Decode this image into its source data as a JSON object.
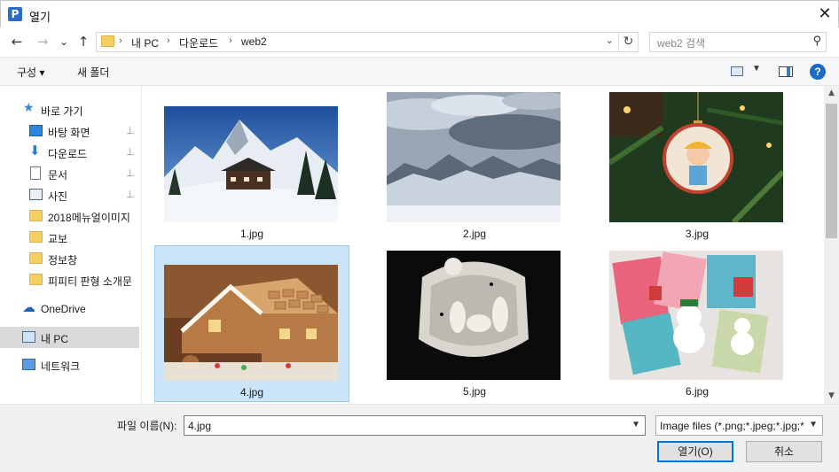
{
  "window": {
    "title": "열기",
    "app_icon_letter": "P",
    "close_glyph": "✕"
  },
  "nav": {
    "back_glyph": "←",
    "forward_glyph": "→",
    "recent_glyph": "⌄",
    "up_glyph": "↑",
    "breadcrumb": [
      "내 PC",
      "다운로드",
      "web2"
    ],
    "separator": "›",
    "refresh_glyph": "↻",
    "search_placeholder": "web2 검색",
    "search_glyph": "⚲"
  },
  "toolbar": {
    "organize_label": "구성 ▾",
    "new_folder_label": "새 폴더",
    "help_glyph": "?"
  },
  "sidebar": {
    "quick_access": "바로 가기",
    "items": [
      {
        "label": "바탕 화면",
        "pinned": true
      },
      {
        "label": "다운로드",
        "pinned": true
      },
      {
        "label": "문서",
        "pinned": true
      },
      {
        "label": "사진",
        "pinned": true
      },
      {
        "label": "2018메뉴얼이미지",
        "pinned": false
      },
      {
        "label": "교보",
        "pinned": false
      },
      {
        "label": "정보창",
        "pinned": false
      },
      {
        "label": "피피티 판형 소개문",
        "pinned": false
      }
    ],
    "onedrive": "OneDrive",
    "this_pc": "내 PC",
    "network": "네트워크",
    "pin_glyph": "📌"
  },
  "files": [
    {
      "name": "1.jpg",
      "selected": false
    },
    {
      "name": "2.jpg",
      "selected": false
    },
    {
      "name": "3.jpg",
      "selected": false
    },
    {
      "name": "4.jpg",
      "selected": true
    },
    {
      "name": "5.jpg",
      "selected": false
    },
    {
      "name": "6.jpg",
      "selected": false
    }
  ],
  "bottom": {
    "filename_label": "파일 이름(N):",
    "filename_value": "4.jpg",
    "filter_value": "Image files (*.png;*.jpeg;*.jpg;*",
    "open_button": "열기(O)",
    "cancel_button": "취소"
  },
  "colors": {
    "selection": "#cce4f7",
    "accent": "#0078d7"
  }
}
